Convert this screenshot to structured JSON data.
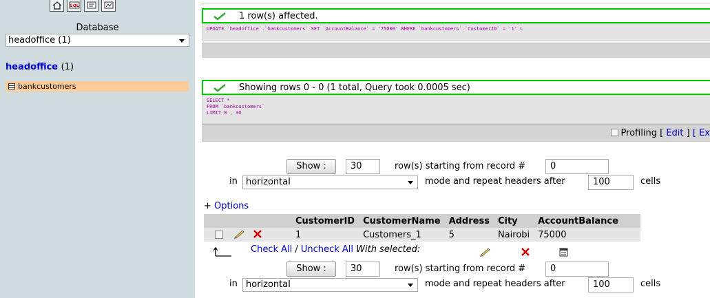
{
  "sidebar": {
    "database_label": "Database",
    "database_select": "headoffice (1)",
    "db_name": "headoffice",
    "db_count": "(1)",
    "table_item": "bankcustomers",
    "top_icons": [
      "home-icon",
      "sql-icon",
      "query-window-icon",
      "docs-icon"
    ],
    "sql_icon_text": "SQL"
  },
  "messages": {
    "update": {
      "text": "1 row(s) affected.",
      "sql": "UPDATE `headoffice`.`bankcustomers` SET `AccountBalance` = '75000' WHERE `bankcustomers`.`CustomerID` = '1' L"
    },
    "select": {
      "text": "Showing rows 0 - 0 (1 total, Query took 0.0005 sec)",
      "sql_line1": "SELECT *",
      "sql_line2": "FROM `bankcustomers`",
      "sql_line3": "LIMIT 0 , 30"
    }
  },
  "profiling": {
    "label": "Profiling",
    "open_bracket": "[",
    "edit": "Edit",
    "close_bracket": "]",
    "explain": "[ Ex"
  },
  "nav_top": {
    "show_button": "Show :",
    "rows_value": "30",
    "starting_label": "row(s) starting from record #",
    "start_value": "0",
    "in_label": "in",
    "mode_value": "horizontal",
    "mode_label": "mode and repeat headers after",
    "repeat_value": "100",
    "cells_label": "cells"
  },
  "options_prefix": "+ ",
  "options_link": "Options",
  "table": {
    "headers": [
      "CustomerID",
      "CustomerName",
      "Address",
      "City",
      "AccountBalance"
    ],
    "rows": [
      {
        "CustomerID": "1",
        "CustomerName": "Customers_1",
        "Address": "5",
        "City": "Nairobi",
        "AccountBalance": "75000"
      }
    ]
  },
  "bulk": {
    "check_all": "Check All",
    "separator": " / ",
    "uncheck_all": "Uncheck All",
    "with_selected": "With selected:"
  },
  "nav_bottom": {
    "show_button": "Show :",
    "rows_value": "30",
    "starting_label": "row(s) starting from record #",
    "start_value": "0",
    "in_label": "in",
    "mode_value": "horizontal",
    "mode_label": "mode and repeat headers after",
    "repeat_value": "100",
    "cells_label": "cells"
  },
  "colors": {
    "sidebar_bg": "#d0dce0",
    "success_border": "#00cc00",
    "link": "#0000cc",
    "selected_table": "#ffcc99"
  }
}
